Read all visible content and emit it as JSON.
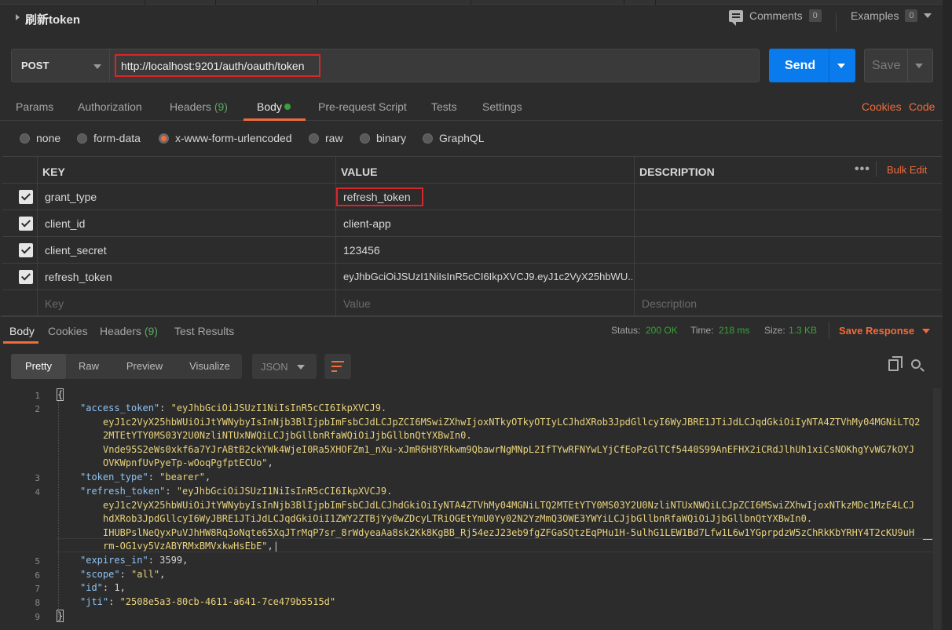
{
  "header": {
    "title": "刷新token",
    "comments_label": "Comments",
    "comments_count": "0",
    "examples_label": "Examples",
    "examples_count": "0"
  },
  "request": {
    "method": "POST",
    "url": "http://localhost:9201/auth/oauth/token",
    "send_label": "Send",
    "save_label": "Save"
  },
  "request_tabs": {
    "params": "Params",
    "authorization": "Authorization",
    "headers": "Headers",
    "headers_count": "(9)",
    "body": "Body",
    "prerequest": "Pre-request Script",
    "tests": "Tests",
    "settings": "Settings",
    "cookies": "Cookies",
    "code": "Code"
  },
  "body_types": {
    "none": "none",
    "form_data": "form-data",
    "urlencoded": "x-www-form-urlencoded",
    "raw": "raw",
    "binary": "binary",
    "graphql": "GraphQL",
    "selected": "x-www-form-urlencoded"
  },
  "params_table": {
    "headers": {
      "key": "KEY",
      "value": "VALUE",
      "description": "DESCRIPTION"
    },
    "bulk_edit": "Bulk Edit",
    "rows": [
      {
        "key": "grant_type",
        "value": "refresh_token",
        "checked": true
      },
      {
        "key": "client_id",
        "value": "client-app",
        "checked": true
      },
      {
        "key": "client_secret",
        "value": "123456",
        "checked": true
      },
      {
        "key": "refresh_token",
        "value": "eyJhbGciOiJSUzI1NiIsInR5cCI6IkpXVCJ9.eyJ1c2VyX25hbWU...",
        "checked": true
      }
    ],
    "placeholder": {
      "key": "Key",
      "value": "Value",
      "description": "Description"
    }
  },
  "response": {
    "tabs": {
      "body": "Body",
      "cookies": "Cookies",
      "headers": "Headers",
      "headers_count": "(9)",
      "test_results": "Test Results"
    },
    "status_label": "Status:",
    "status_value": "200 OK",
    "time_label": "Time:",
    "time_value": "218 ms",
    "size_label": "Size:",
    "size_value": "1.3 KB",
    "save_response": "Save Response",
    "view_modes": {
      "pretty": "Pretty",
      "raw": "Raw",
      "preview": "Preview",
      "visualize": "Visualize"
    },
    "format": "JSON"
  },
  "code_lines": {
    "l1": "{",
    "l2_key": "\"access_token\"",
    "l2_val_a": "\"eyJhbGciOiJSUzI1NiIsInR5cCI6IkpXVCJ9.",
    "l2_val_b": "eyJ1c2VyX25hbWUiOiJtYWNybyIsInNjb3BlIjpbImFsbCJdLCJpZCI6MSwiZXhwIjoxNTkyOTkyOTIyLCJhdXRob3JpdGllcyI6WyJBRE1JTiJdLCJqdGkiOiIyNTA4ZTVhMy04MGNiLTQ2",
    "l2_val_c": "2MTEtYTY0MS03Y2U0NzliNTUxNWQiLCJjbGllbnRfaWQiOiJjbGllbnQtYXBwIn0.",
    "l2_val_d": "Vnde95S2eWs0xkf6a7YJrABtB2ckYWk4WjeI0Ra5XHOFZm1_nXu-xJmR6H8YRkwm9QbawrNgMNpL2IfTYwRFNYwLYjCfEoPzGlTCf5440S99AnEFHX2iCRdJlhUh1xiCsNOKhgYvWG7kOYJ",
    "l2_val_e": "OVKWpnfUvPyeTp-wOoqPgfptECUo\"",
    "l3_key": "\"token_type\"",
    "l3_val": "\"bearer\"",
    "l4_key": "\"refresh_token\"",
    "l4_val_a": "\"eyJhbGciOiJSUzI1NiIsInR5cCI6IkpXVCJ9.",
    "l4_val_b": "eyJ1c2VyX25hbWUiOiJtYWNybyIsInNjb3BlIjpbImFsbCJdLCJhdGkiOiIyNTA4ZTVhMy04MGNiLTQ2MTEtYTY0MS03Y2U0NzliNTUxNWQiLCJpZCI6MSwiZXhwIjoxNTkzMDc1MzE4LCJ",
    "l4_val_c": "hdXRob3JpdGllcyI6WyJBRE1JTiJdLCJqdGkiOiI1ZWY2ZTBjYy0wZDcyLTRiOGEtYmU0Yy02N2YzMmQ3OWE3YWYiLCJjbGllbnRfaWQiOiJjbGllbnQtYXBwIn0.",
    "l4_val_d": "IHUBPslNeQyxPuVJhHW8Rq3oNqte65XqJTrMqP7sr_8rWdyeaAa8sk2Kk8KgBB_Rj54ezJ23eb9fgZFGaSQtzEqPHu1H-5ulhG1LEW1Bd7Lfw1L6w1YGprpdzW5zChRkKbYRHY4T2cKU9uH",
    "l4_val_e": "rm-OG1vy5VzABYRMxBMVxkwHsEbE\"",
    "l5_key": "\"expires_in\"",
    "l5_val": "3599",
    "l6_key": "\"scope\"",
    "l6_val": "\"all\"",
    "l7_key": "\"id\"",
    "l7_val": "1",
    "l8_key": "\"jti\"",
    "l8_val": "\"2508e5a3-80cb-4611-a641-7ce479b5515d\"",
    "l9": "}"
  },
  "line_numbers": [
    "1",
    "2",
    "3",
    "4",
    "5",
    "6",
    "7",
    "8",
    "9"
  ],
  "colors": {
    "accent": "#f26b3a",
    "send": "#097bed",
    "status_ok": "#37a337",
    "highlight": "#d9262b"
  }
}
